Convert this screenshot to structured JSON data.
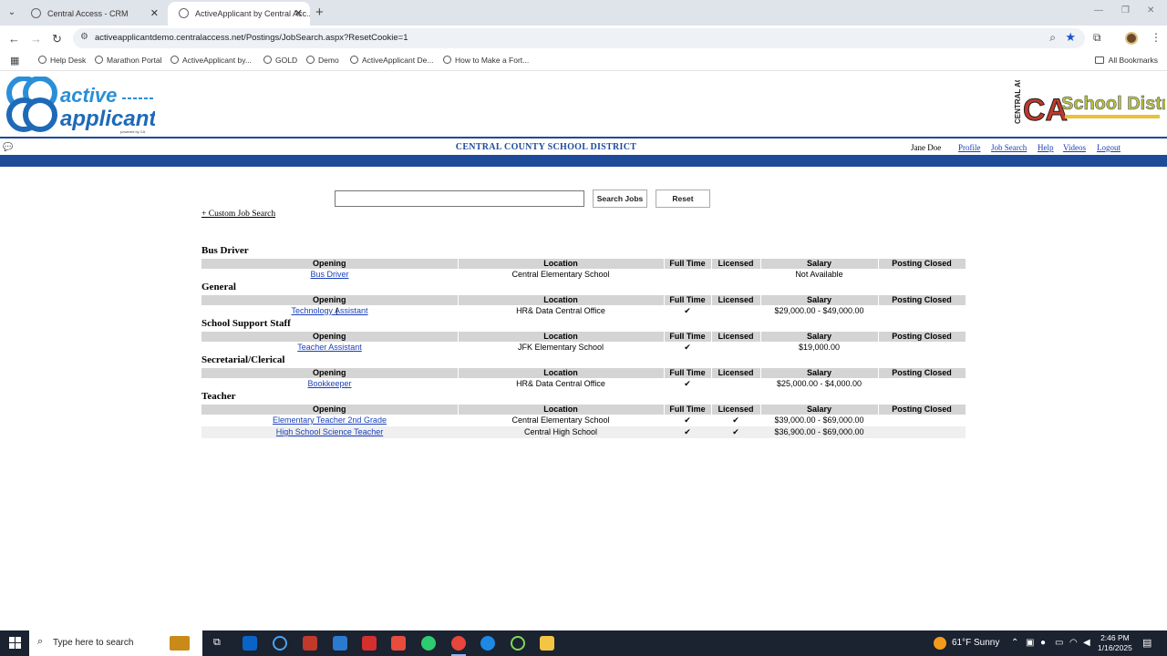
{
  "browser": {
    "tabs": [
      {
        "title": "Central Access - CRM"
      },
      {
        "title": "ActiveApplicant by Central Acc..."
      }
    ],
    "url": "activeapplicantdemo.centralaccess.net/Postings/JobSearch.aspx?ResetCookie=1",
    "bookmarks": [
      "Help Desk",
      "Marathon Portal",
      "ActiveApplicant by...",
      "GOLD",
      "Demo",
      "ActiveApplicant De...",
      "How to Make a Fort..."
    ],
    "all_bookmarks": "All Bookmarks"
  },
  "header": {
    "district": "CENTRAL COUNTY SCHOOL DISTRICT",
    "user": "Jane Doe",
    "nav": [
      "Profile",
      "Job Search",
      "Help",
      "Videos",
      "Logout"
    ],
    "logo_left_text": "active applicant",
    "logo_left_sub": "powered by CA",
    "logo_right_text": "School District",
    "logo_right_side": "CENTRAL ACCESS",
    "logo_right_mark": "CA"
  },
  "search": {
    "value": "",
    "search_label": "Search Jobs",
    "reset_label": "Reset",
    "custom_link": "+ Custom Job Search"
  },
  "columns": [
    "Opening",
    "Location",
    "Full Time",
    "Licensed",
    "Salary",
    "Posting Closed"
  ],
  "categories": [
    {
      "name": "Bus Driver",
      "rows": [
        {
          "opening": "Bus Driver",
          "location": "Central Elementary School",
          "full_time": "",
          "licensed": "",
          "salary": "Not Available",
          "closed": ""
        }
      ]
    },
    {
      "name": "General",
      "rows": [
        {
          "opening": "Technology Assistant",
          "location": "HR& Data Central Office",
          "full_time": "✔",
          "licensed": "",
          "salary": "$29,000.00 - $49,000.00",
          "closed": ""
        }
      ]
    },
    {
      "name": "School Support Staff",
      "rows": [
        {
          "opening": "Teacher Assistant",
          "location": "JFK Elementary School",
          "full_time": "✔",
          "licensed": "",
          "salary": "$19,000.00",
          "closed": ""
        }
      ]
    },
    {
      "name": "Secretarial/Clerical",
      "rows": [
        {
          "opening": "Bookkeeper",
          "location": "HR& Data Central Office",
          "full_time": "✔",
          "licensed": "",
          "salary": "$25,000.00 - $4,000.00",
          "closed": ""
        }
      ]
    },
    {
      "name": "Teacher",
      "rows": [
        {
          "opening": "Elementary Teacher 2nd Grade",
          "location": "Central Elementary School",
          "full_time": "✔",
          "licensed": "✔",
          "salary": "$39,000.00 - $69,000.00",
          "closed": ""
        },
        {
          "opening": "High School Science Teacher",
          "location": "Central High School",
          "full_time": "✔",
          "licensed": "✔",
          "salary": "$36,900.00 - $69,000.00",
          "closed": ""
        }
      ]
    }
  ],
  "taskbar": {
    "search_placeholder": "Type here to search",
    "weather": "61°F  Sunny",
    "time": "2:46 PM",
    "date": "1/16/2025"
  },
  "colors": {
    "brand_blue": "#1e4a9a",
    "link_blue": "#1a3fb8",
    "header_gray": "#d4d4d4"
  }
}
